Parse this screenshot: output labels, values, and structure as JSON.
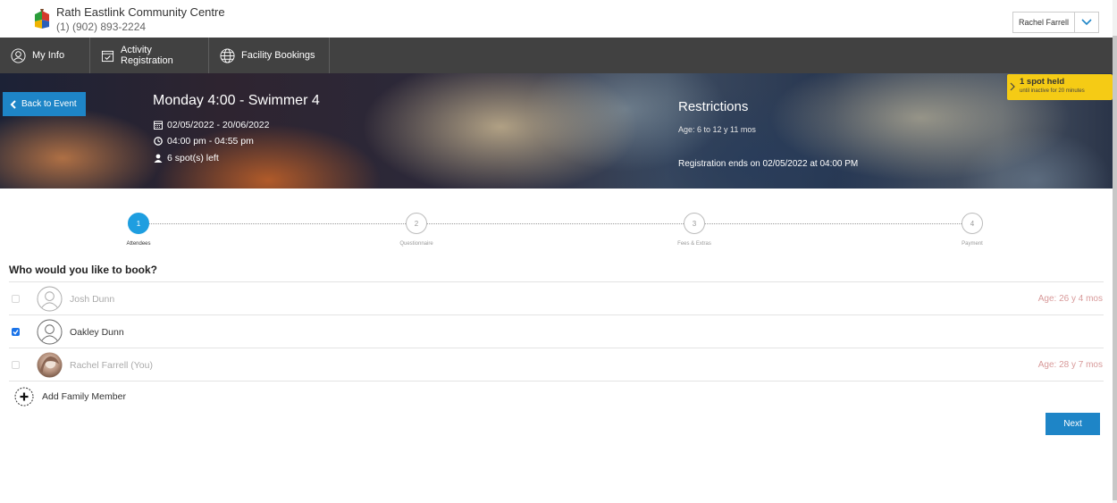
{
  "header": {
    "org_name": "Rath Eastlink Community Centre",
    "org_phone": "(1) (902) 893-2224",
    "user_name": "Rachel Farrell"
  },
  "nav": {
    "my_info": "My Info",
    "activity_registration": "Activity Registration",
    "facility_bookings": "Facility Bookings"
  },
  "event": {
    "back_label": "Back to Event",
    "title": "Monday 4:00 - Swimmer 4",
    "dates": "02/05/2022 - 20/06/2022",
    "time": "04:00 pm - 04:55 pm",
    "spots": "6 spot(s) left"
  },
  "restrictions": {
    "title": "Restrictions",
    "age": "Age: 6 to 12 y 11 mos",
    "registration": "Registration ends on 02/05/2022 at 04:00 PM"
  },
  "spot_held": {
    "title": "1 spot held",
    "subtitle": "until inactive for 20 minutes",
    "color": "#f5cb15"
  },
  "steps": [
    {
      "number": "1",
      "label": "Attendees"
    },
    {
      "number": "2",
      "label": "Questionnaire"
    },
    {
      "number": "3",
      "label": "Fees & Extras"
    },
    {
      "number": "4",
      "label": "Payment"
    }
  ],
  "question": "Who would you like to book?",
  "attendees": [
    {
      "name": "Josh Dunn",
      "age": "Age: 26 y 4 mos",
      "checked": false
    },
    {
      "name": "Oakley Dunn",
      "age": "",
      "checked": true
    },
    {
      "name": "Rachel Farrell (You)",
      "age": "Age: 28 y 7 mos",
      "checked": false
    }
  ],
  "add_family": "Add Family Member",
  "next_label": "Next",
  "colors": {
    "accent": "#1e85c7",
    "nav_bg": "#414141",
    "age_text": "#d89a9a"
  }
}
